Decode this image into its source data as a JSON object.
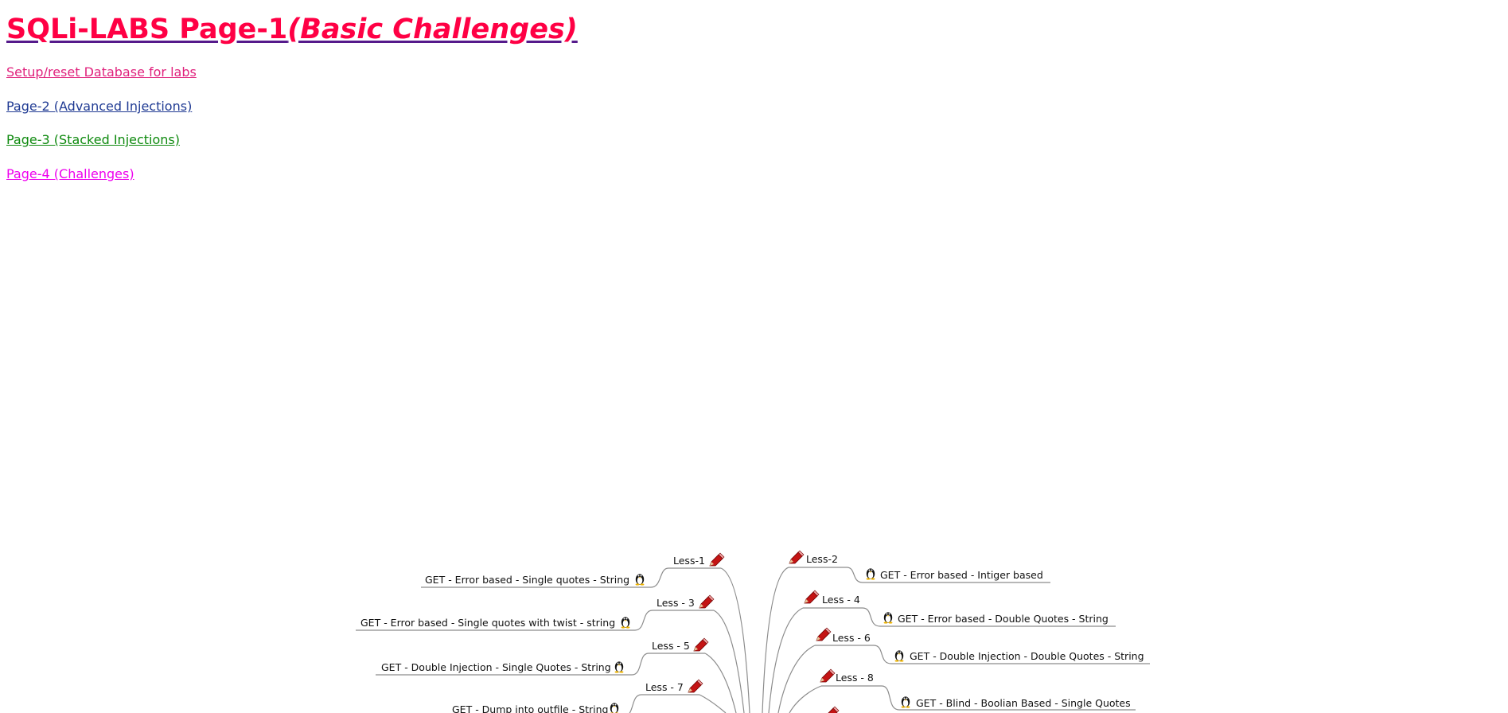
{
  "header": {
    "title_main": "SQLi-LABS Page-1",
    "title_italic": "(Basic Challenges)"
  },
  "nav": {
    "setup_reset": "Setup/reset Database for labs",
    "page2": "Page-2 (Advanced Injections)",
    "page3": "Page-3 (Stacked Injections)",
    "page4": "Page-4 (Challenges)"
  },
  "colors": {
    "title": "#ff0044",
    "title_underline": "#551a8b",
    "setup_reset": "#e0217c",
    "page2": "#1f3a93",
    "page3": "#0f8a0f",
    "page4": "#ee00ee",
    "pencil": "#c41414",
    "branch_line": "#8c8c8c"
  },
  "mindmap": {
    "icons": {
      "lesson": "pencil-icon",
      "challenge": "linux-penguin-icon"
    },
    "left_lessons": [
      {
        "lesson": "Less-1",
        "challenge": "GET - Error based - Single quotes - String"
      },
      {
        "lesson": "Less - 3",
        "challenge": "GET - Error based - Single quotes with twist - string"
      },
      {
        "lesson": "Less - 5",
        "challenge": "GET - Double Injection - Single Quotes - String"
      },
      {
        "lesson": "Less - 7",
        "challenge": "GET - Dump into outfile - String"
      }
    ],
    "right_lessons": [
      {
        "lesson": "Less-2",
        "challenge": "GET - Error based - Intiger based"
      },
      {
        "lesson": "Less - 4",
        "challenge": "GET - Error based - Double Quotes - String"
      },
      {
        "lesson": "Less - 6",
        "challenge": "GET - Double Injection - Double Quotes - String"
      },
      {
        "lesson": "Less - 8",
        "challenge": "GET - Blind - Boolian Based - Single Quotes"
      }
    ]
  }
}
